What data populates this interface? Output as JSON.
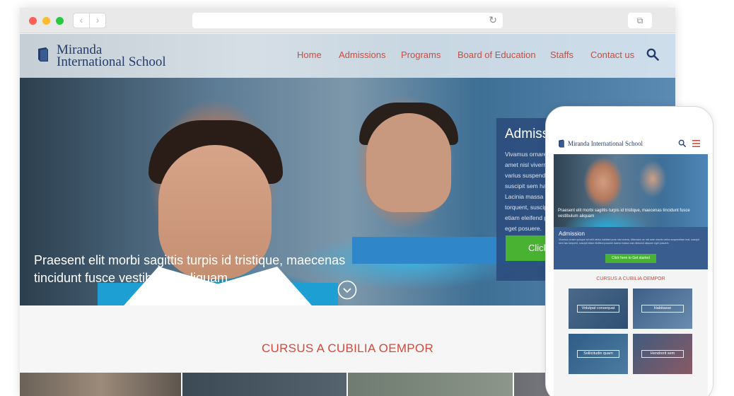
{
  "browser": {
    "back_label": "‹",
    "forward_label": "›",
    "reload_glyph": "↻",
    "tabs_glyph": "⧉"
  },
  "site": {
    "logo_line1": "Miranda",
    "logo_line2": "International School",
    "nav": [
      "Home",
      "Admissions",
      "Programs",
      "Board of Education",
      "Staffs",
      "Contact us"
    ],
    "accent_color": "#d14a3c",
    "brand_color": "#243c6b"
  },
  "hero": {
    "caption": "Praesent elit morbi sagittis turpis id tristique, maecenas tincidunt fusce vestibulum aliquam"
  },
  "admission_panel": {
    "title": "Admiss",
    "text_lines": [
      "Vivamus ornare c",
      "amet nisl viverra",
      "varius suspendis",
      "suscipit sem hac",
      "Lacinia massa cr",
      "torquent, suscip",
      "etiam eleifend p",
      "eget posuere."
    ],
    "button_label": "Click"
  },
  "section": {
    "title": "CURSUS A CUBILIA OEMPOR"
  },
  "mobile": {
    "logo": "Miranda International School",
    "hero_text": "Praesent elit morbi sagittis turpis id tristique, maecenas tincidunt fusce vestibulum aliquam",
    "admission_title": "Admission",
    "admission_text": "Vivamus ornare quisque ad velit varius habitant proin nisl viverra, bibendum ac nisi ante mauris varius suspendisse erat, suscipit sem hac torquent, suscipit etiam eleifend posuere lacinia massa cras dictumst aliquam eget posuere.",
    "button_label": "Click here to Get started",
    "section_title": "CURSUS A CUBILIA OEMPOR",
    "tiles": [
      "Volutpat consequat",
      "Habitasse",
      "Sollicitudin quam",
      "Hendrerit sem"
    ]
  }
}
